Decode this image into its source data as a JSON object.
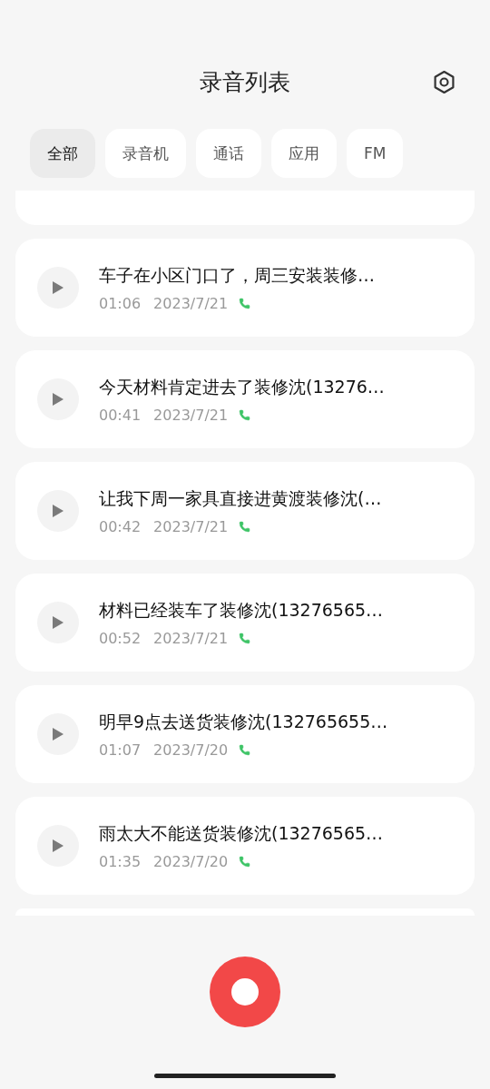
{
  "header": {
    "title": "录音列表"
  },
  "tabs": [
    {
      "label": "全部",
      "selected": true
    },
    {
      "label": "录音机",
      "selected": false
    },
    {
      "label": "通话",
      "selected": false
    },
    {
      "label": "应用",
      "selected": false
    },
    {
      "label": "FM",
      "selected": false
    }
  ],
  "recordings": [
    {
      "title": "车子在小区门口了，周三安装装修…",
      "duration": "01:06",
      "date": "2023/7/21",
      "kind": "call"
    },
    {
      "title": "今天材料肯定进去了装修沈(13276…",
      "duration": "00:41",
      "date": "2023/7/21",
      "kind": "call"
    },
    {
      "title": "让我下周一家具直接进黄渡装修沈(…",
      "duration": "00:42",
      "date": "2023/7/21",
      "kind": "call"
    },
    {
      "title": "材料已经装车了装修沈(13276565…",
      "duration": "00:52",
      "date": "2023/7/21",
      "kind": "call"
    },
    {
      "title": "明早9点去送货装修沈(132765655…",
      "duration": "01:07",
      "date": "2023/7/20",
      "kind": "call"
    },
    {
      "title": "雨太大不能送货装修沈(13276565…",
      "duration": "01:35",
      "date": "2023/7/20",
      "kind": "call"
    }
  ]
}
